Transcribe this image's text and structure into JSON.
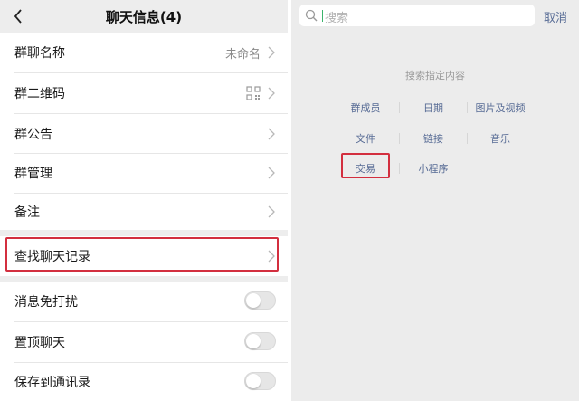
{
  "left": {
    "title": "聊天信息(4)",
    "rows": {
      "group_name": {
        "label": "群聊名称",
        "value": "未命名"
      },
      "qr_code": {
        "label": "群二维码"
      },
      "announcement": {
        "label": "群公告"
      },
      "management": {
        "label": "群管理"
      },
      "remark": {
        "label": "备注"
      },
      "find_history": {
        "label": "查找聊天记录"
      },
      "mute": {
        "label": "消息免打扰",
        "on": false
      },
      "pin": {
        "label": "置顶聊天",
        "on": false
      },
      "save_contacts": {
        "label": "保存到通讯录",
        "on": false
      }
    }
  },
  "right": {
    "search": {
      "placeholder": "搜索"
    },
    "cancel": "取消",
    "hint": "搜索指定内容",
    "categories": [
      "群成员",
      "日期",
      "图片及视频",
      "文件",
      "链接",
      "音乐",
      "交易",
      "小程序"
    ]
  },
  "colors": {
    "highlight_border": "#d32f3f",
    "link_blue": "#576b95",
    "cursor_green": "#3ab36b"
  }
}
